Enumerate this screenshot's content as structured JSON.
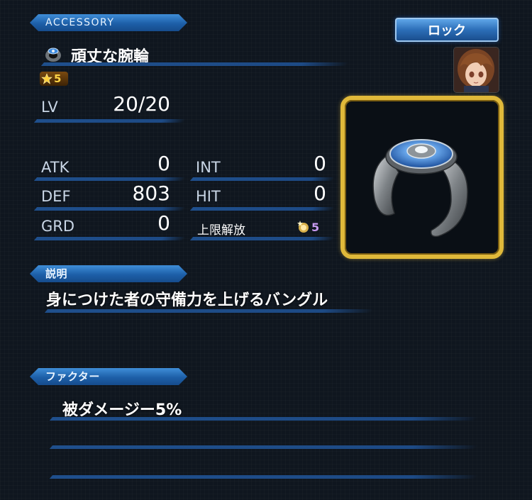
{
  "header": {
    "category_label": "ACCESSORY"
  },
  "lock_button": {
    "label": "ロック"
  },
  "item": {
    "name": "頑丈な腕輪",
    "rarity": "5",
    "level_label": "LV",
    "level_value": "20/20"
  },
  "stats": {
    "atk": {
      "label": "ATK",
      "value": "0"
    },
    "def": {
      "label": "DEF",
      "value": "803"
    },
    "grd": {
      "label": "GRD",
      "value": "0"
    },
    "int": {
      "label": "INT",
      "value": "0"
    },
    "hit": {
      "label": "HIT",
      "value": "0"
    },
    "limit_break": {
      "label": "上限解放",
      "value": "5"
    }
  },
  "description": {
    "header": "説明",
    "text": "身につけた者の守備力を上げるバングル"
  },
  "factor": {
    "header": "ファクター",
    "text": "被ダメージー5%"
  },
  "colors": {
    "accent_blue": "#2c6eb8",
    "frame_gold": "#e0b93a",
    "background": "#0f161f"
  },
  "icons": {
    "item_icon": "ring-icon",
    "rarity_icon": "star-icon",
    "limit_break_icon": "limit-break-icon",
    "portrait": "character-portrait"
  }
}
